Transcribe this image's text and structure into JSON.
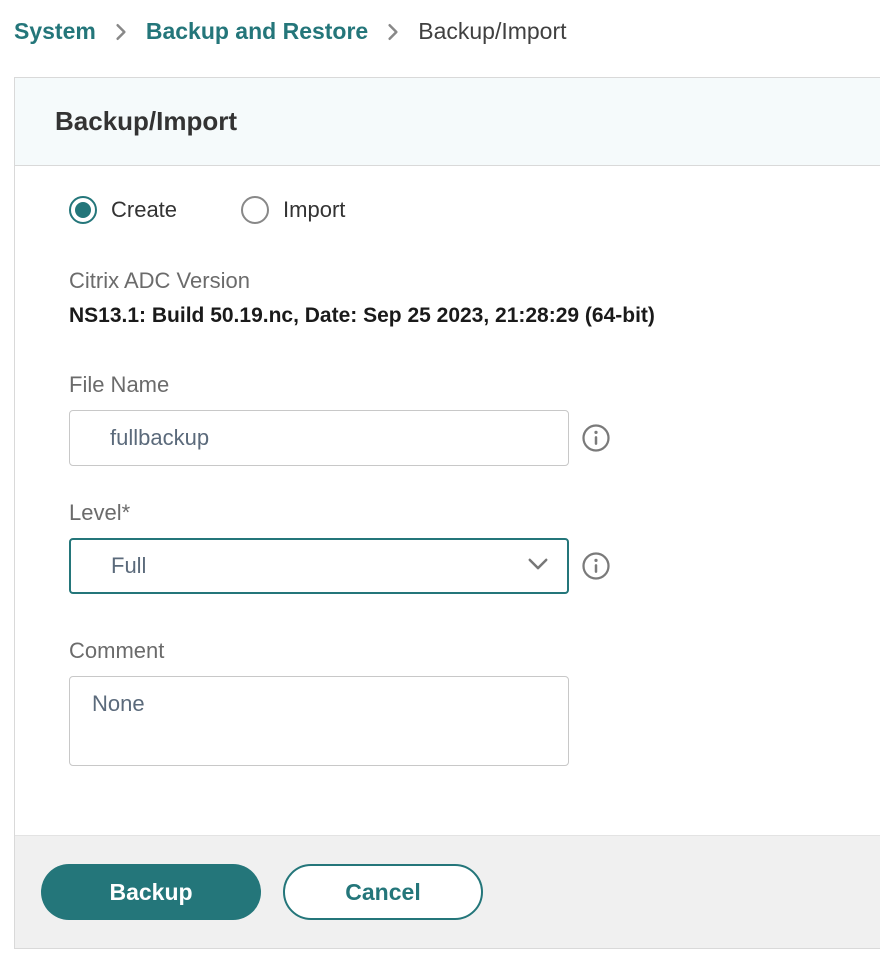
{
  "breadcrumb": {
    "items": [
      {
        "label": "System",
        "link": true
      },
      {
        "label": "Backup and Restore",
        "link": true
      },
      {
        "label": "Backup/Import",
        "link": false
      }
    ]
  },
  "panel": {
    "title": "Backup/Import"
  },
  "form": {
    "mode": {
      "options": [
        {
          "label": "Create",
          "selected": true
        },
        {
          "label": "Import",
          "selected": false
        }
      ]
    },
    "version": {
      "label": "Citrix ADC Version",
      "value": "NS13.1: Build 50.19.nc, Date: Sep 25 2023, 21:28:29   (64-bit)"
    },
    "fileName": {
      "label": "File Name",
      "value": "fullbackup"
    },
    "level": {
      "label": "Level*",
      "value": "Full"
    },
    "comment": {
      "label": "Comment",
      "value": "None"
    }
  },
  "buttons": {
    "primary": "Backup",
    "secondary": "Cancel"
  }
}
